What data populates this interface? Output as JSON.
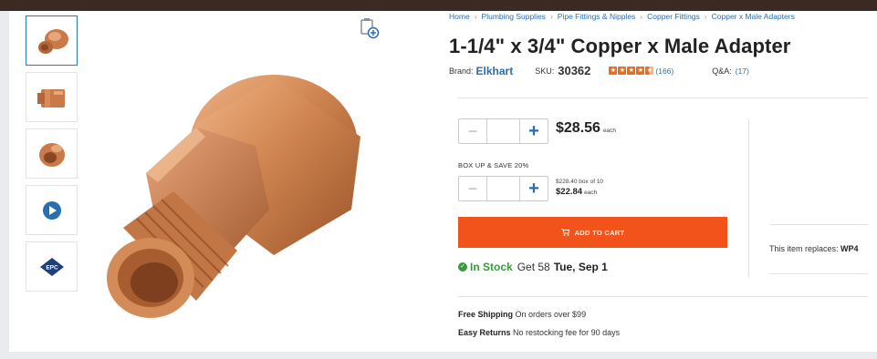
{
  "breadcrumbs": [
    "Home",
    "Plumbing Supplies",
    "Pipe Fittings & Nipples",
    "Copper Fittings",
    "Copper x Male Adapters"
  ],
  "product": {
    "title": "1-1/4\" x 3/4\" Copper x Male Adapter",
    "brand_label": "Brand:",
    "brand": "Elkhart",
    "sku_label": "SKU:",
    "sku": "30362",
    "rating": 4.5,
    "reviews": "(166)",
    "qa_label": "Q&A:",
    "qa_count": "(17)"
  },
  "purchase": {
    "qty_minus": "−",
    "qty_plus": "+",
    "qty_value": "",
    "price": "$28.56",
    "each": "each",
    "box_label": "BOX UP & SAVE 20%",
    "box_price_line": "$228.40 box of 10",
    "box_each_price": "$22.84",
    "box_each": "each",
    "add_to_cart": "ADD TO CART"
  },
  "stock": {
    "status": "In Stock",
    "get_text": "Get 58",
    "date": "Tue, Sep 1"
  },
  "benefits": {
    "shipping_title": "Free Shipping",
    "shipping_text": "On orders over $99",
    "returns_title": "Easy Returns",
    "returns_text": "No restocking fee for 90 days"
  },
  "replaces": {
    "label": "This item replaces:",
    "value": "WP4"
  },
  "thumbnails": [
    {
      "icon": "fitting-image",
      "active": true
    },
    {
      "icon": "fitting-side-image",
      "active": false
    },
    {
      "icon": "fitting-angle-image",
      "active": false
    },
    {
      "icon": "play-video-icon",
      "active": false
    },
    {
      "icon": "epc-logo",
      "active": false,
      "text": "EPC"
    }
  ],
  "colors": {
    "accent": "#f2531b",
    "link": "#2a6eb0",
    "in_stock": "#3a9a3a",
    "copper": "#c87a4a"
  }
}
